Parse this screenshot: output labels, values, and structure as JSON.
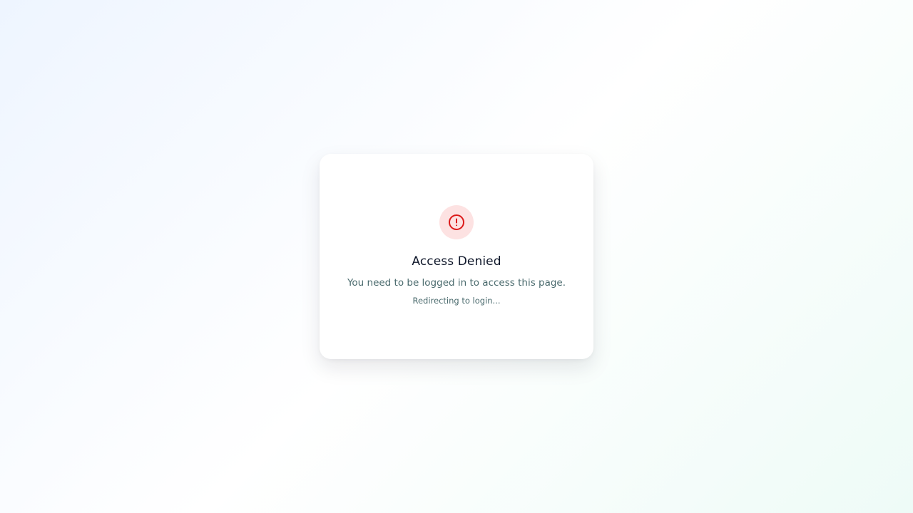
{
  "access_denied": {
    "icon": "alert-circle-icon",
    "title": "Access Denied",
    "message": "You need to be logged in to access this page.",
    "redirect_text": "Redirecting to login..."
  },
  "colors": {
    "background_start": "#eef5ff",
    "background_end": "#eefbf7",
    "card": "#ffffff",
    "icon_bg": "#fde2e2",
    "icon_stroke": "#dc1a1a",
    "title": "#0f172a",
    "muted_text": "#4b6b6e"
  }
}
